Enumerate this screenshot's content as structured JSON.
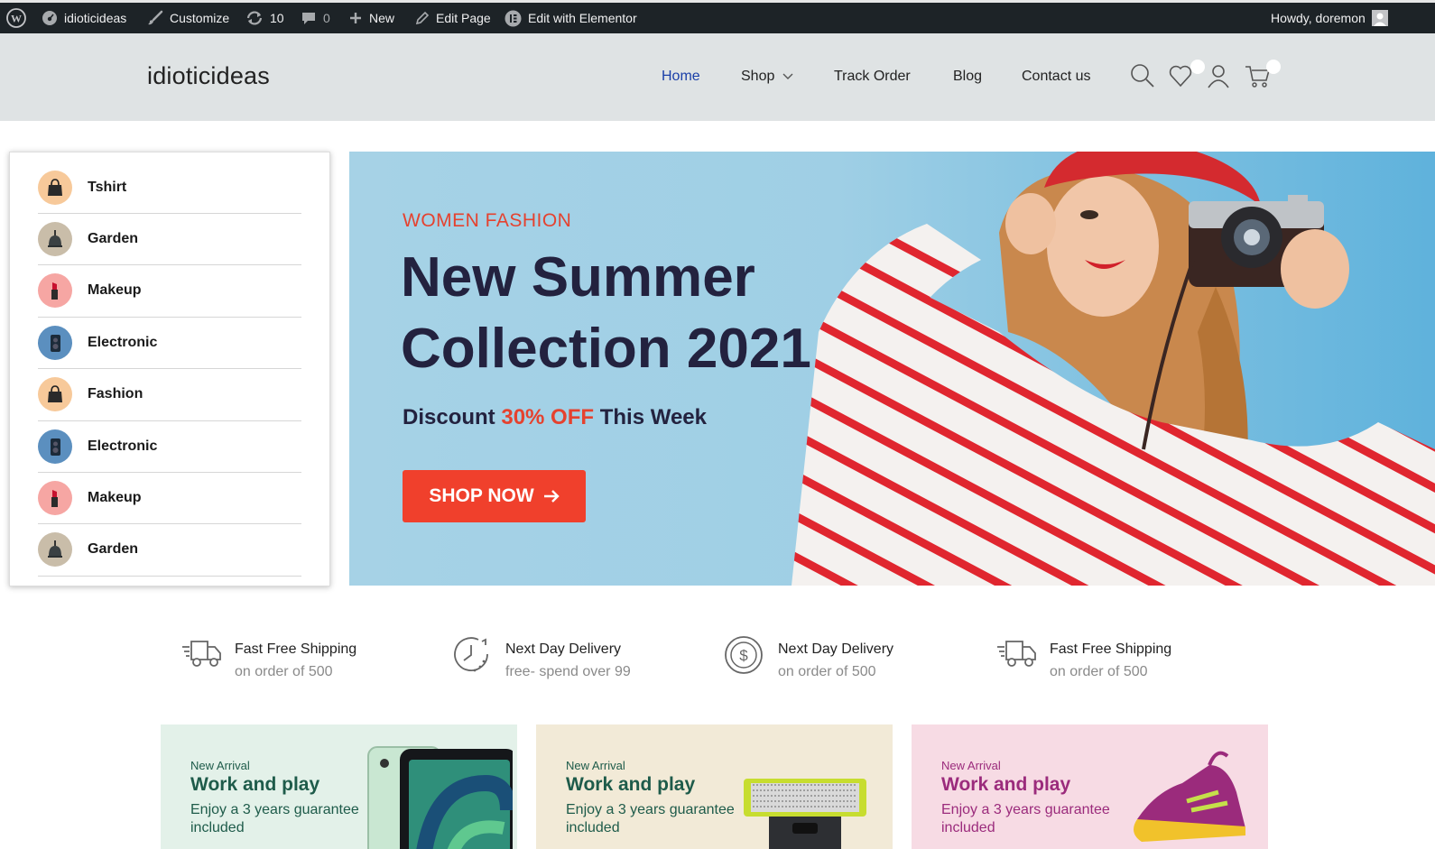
{
  "admin_bar": {
    "site_name": "idioticideas",
    "customize": "Customize",
    "updates": "10",
    "comments": "0",
    "new": "New",
    "edit_page": "Edit Page",
    "edit_elementor": "Edit with Elementor",
    "howdy": "Howdy, doremon"
  },
  "header": {
    "logo": "idioticideas",
    "nav": [
      "Home",
      "Shop",
      "Track Order",
      "Blog",
      "Contact us"
    ],
    "active_nav": "Home"
  },
  "categories": [
    {
      "label": "Tshirt",
      "icon": "handbag-icon",
      "bg": "#f7c99a"
    },
    {
      "label": "Garden",
      "icon": "lamp-icon",
      "bg": "#c9bda9"
    },
    {
      "label": "Makeup",
      "icon": "lipstick-icon",
      "bg": "#f6a6a3"
    },
    {
      "label": "Electronic",
      "icon": "speaker-icon",
      "bg": "#5b8fbf"
    },
    {
      "label": "Fashion",
      "icon": "handbag-icon",
      "bg": "#f7c99a"
    },
    {
      "label": "Electronic",
      "icon": "speaker-icon",
      "bg": "#5b8fbf"
    },
    {
      "label": "Makeup",
      "icon": "lipstick-icon",
      "bg": "#f6a6a3"
    },
    {
      "label": "Garden",
      "icon": "lamp-icon",
      "bg": "#c9bda9"
    }
  ],
  "hero": {
    "tag": "WOMEN FASHION",
    "title_line1": "New Summer",
    "title_line2": "Collection 2021",
    "discount_pre": "Discount ",
    "discount_hl": "30% OFF",
    "discount_post": " This Week",
    "button": "SHOP NOW"
  },
  "features": [
    {
      "title": "Fast Free Shipping",
      "subtitle": "on order of 500",
      "icon": "truck-icon"
    },
    {
      "title": "Next Day Delivery",
      "subtitle": "free- spend over 99",
      "icon": "clock-icon"
    },
    {
      "title": "Next Day Delivery",
      "subtitle": "on order of 500",
      "icon": "dollar-coin-icon"
    },
    {
      "title": "Fast Free Shipping",
      "subtitle": "on order of 500",
      "icon": "truck-icon"
    }
  ],
  "promos": [
    {
      "tag": "New Arrival",
      "title": "Work and play",
      "desc": "Enjoy a 3 years guarantee included",
      "bg": "#e3f1e9",
      "color": "#1e5b4a",
      "product": "tablet"
    },
    {
      "tag": "New Arrival",
      "title": "Work and play",
      "desc": "Enjoy a 3 years guarantee included",
      "bg": "#f2ead7",
      "color": "#1e5b4a",
      "product": "shaver"
    },
    {
      "tag": "New Arrival",
      "title": "Work and play",
      "desc": "Enjoy a 3 years guarantee included",
      "bg": "#f7dbe4",
      "color": "#9b2b7c",
      "product": "sneaker"
    }
  ],
  "colors": {
    "accent": "#f0402c",
    "nav_active": "#1a3fa8",
    "hero_text": "#23223f"
  }
}
